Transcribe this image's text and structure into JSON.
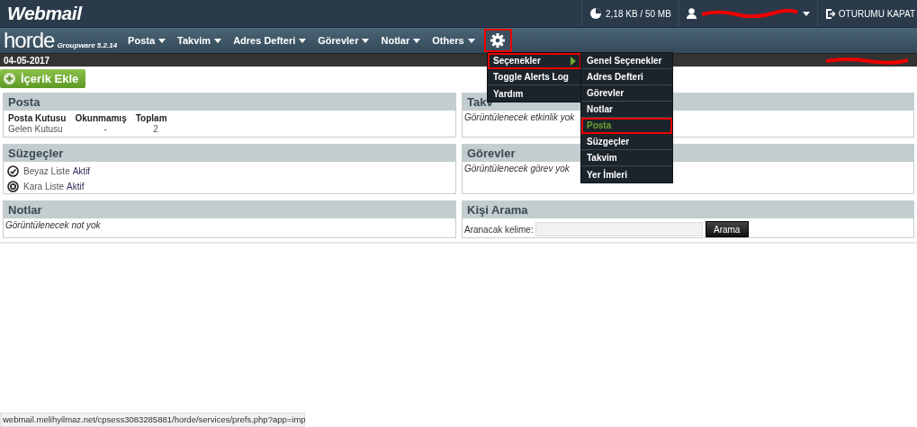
{
  "header": {
    "logo": "Webmail",
    "quota": "2,18 KB / 50 MB",
    "user": {
      "redacted": true
    },
    "logout": "OTURUMU KAPAT"
  },
  "nav": {
    "brand": "horde",
    "version": "Groupware 5.2.14",
    "items": [
      {
        "label": "Posta"
      },
      {
        "label": "Takvim"
      },
      {
        "label": "Adres Defteri"
      },
      {
        "label": "Görevler"
      },
      {
        "label": "Notlar"
      },
      {
        "label": "Others"
      }
    ],
    "settings": {
      "highlighted": true,
      "expanded": true
    }
  },
  "settings_menu": {
    "items": [
      {
        "label": "Seçenekler",
        "has_submenu": true,
        "highlighted": true
      },
      {
        "label": "Toggle Alerts Log",
        "has_submenu": false,
        "highlighted": false
      },
      {
        "label": "Yardım",
        "has_submenu": false,
        "highlighted": false
      }
    ],
    "submenu": [
      {
        "label": "Genel Seçenekler",
        "selected": false,
        "highlighted": false
      },
      {
        "label": "Adres Defteri",
        "selected": false,
        "highlighted": false
      },
      {
        "label": "Görevler",
        "selected": false,
        "highlighted": false
      },
      {
        "label": "Notlar",
        "selected": false,
        "highlighted": false
      },
      {
        "label": "Posta",
        "selected": true,
        "highlighted": true
      },
      {
        "label": "Süzgeçler",
        "selected": false,
        "highlighted": false
      },
      {
        "label": "Takvim",
        "selected": false,
        "highlighted": false
      },
      {
        "label": "Yer İmleri",
        "selected": false,
        "highlighted": false
      }
    ]
  },
  "date_bar": {
    "date": "04-05-2017",
    "redacted": true
  },
  "add_button": "İçerik Ekle",
  "portlets": [
    {
      "kind": "mail",
      "title": "Posta",
      "columns": [
        "Posta Kutusu",
        "Okunmamış",
        "Toplam"
      ],
      "rows": [
        [
          "Gelen Kutusu",
          "-",
          "2"
        ]
      ]
    },
    {
      "kind": "text",
      "title": "Takv",
      "text": "Görüntülenecek etkinlik yok"
    },
    {
      "kind": "filters",
      "title": "Süzgeçler",
      "items": [
        {
          "kind": "whitelist",
          "name": "Beyaz Liste",
          "status": "Aktif"
        },
        {
          "kind": "blacklist",
          "name": "Kara Liste",
          "status": "Aktif"
        }
      ]
    },
    {
      "kind": "text",
      "title": "Görevler",
      "text": "Görüntülenecek görev yok"
    },
    {
      "kind": "text",
      "title": "Notlar",
      "text": "Görüntülenecek not yok"
    },
    {
      "kind": "search",
      "title": "Kişi Arama",
      "label": "Aranacak kelime:",
      "button": "Arama"
    }
  ],
  "status_url": "webmail.melihyilmaz.net/cpsess3083285881/horde/services/prefs.php?app=imp"
}
